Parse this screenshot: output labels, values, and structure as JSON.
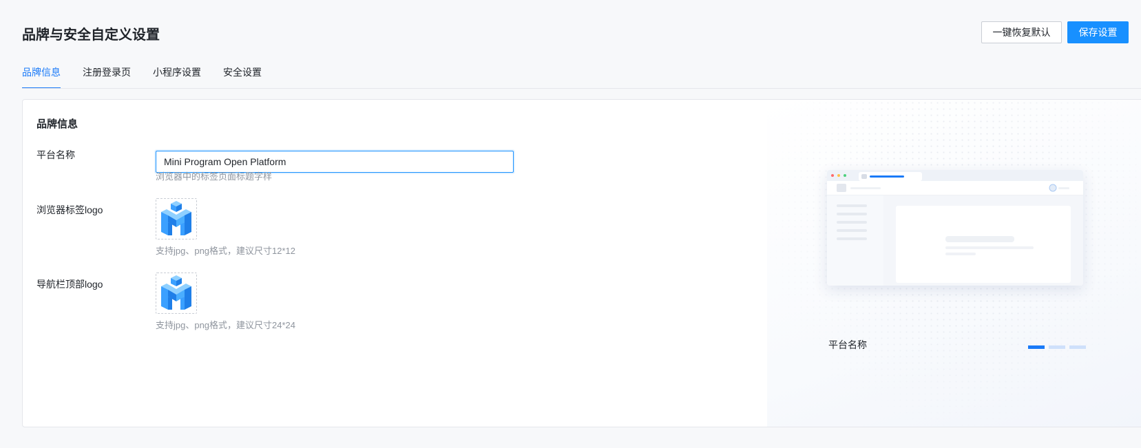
{
  "header": {
    "title": "品牌与安全自定义设置",
    "reset_label": "一键恢复默认",
    "save_label": "保存设置"
  },
  "tabs": [
    {
      "label": "品牌信息",
      "active": true
    },
    {
      "label": "注册登录页",
      "active": false
    },
    {
      "label": "小程序设置",
      "active": false
    },
    {
      "label": "安全设置",
      "active": false
    }
  ],
  "section": {
    "title": "品牌信息"
  },
  "form": {
    "platform_name": {
      "label": "平台名称",
      "value": "Mini Program Open Platform",
      "help": "浏览器中的标签页面标题字样"
    },
    "browser_logo": {
      "label": "浏览器标签logo",
      "help": "支持jpg、png格式，建议尺寸12*12",
      "icon": "m-logo-icon"
    },
    "nav_logo": {
      "label": "导航栏顶部logo",
      "help": "支持jpg、png格式，建议尺寸24*24",
      "icon": "m-logo-icon"
    }
  },
  "preview": {
    "caption": "平台名称",
    "carousel_active_index": 0,
    "carousel_count": 3
  },
  "colors": {
    "accent": "#1890ff",
    "tab_active": "#1a7af8",
    "background": "#f7f8fa"
  }
}
